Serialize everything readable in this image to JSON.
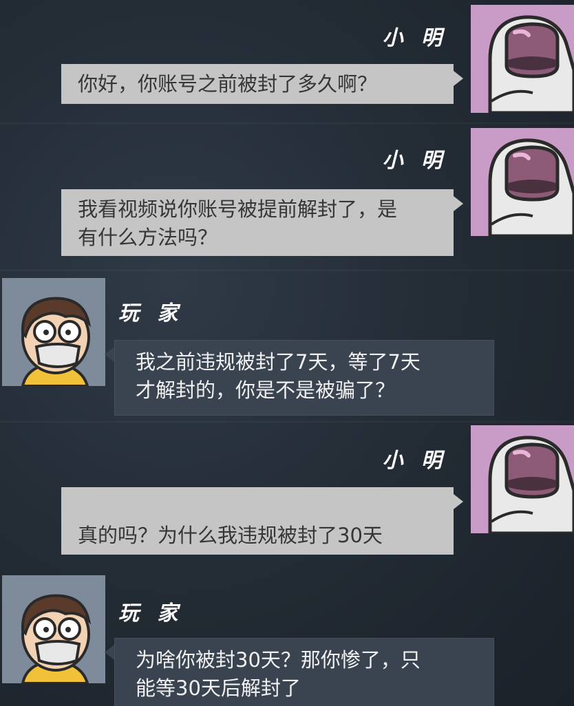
{
  "messages": [
    {
      "sender": "小 明",
      "text": "你好，你账号之前被封了多久啊？"
    },
    {
      "sender": "小 明",
      "text": "我看视频说你账号被提前解封了，是\n有什么方法吗？"
    },
    {
      "sender": "玩 家",
      "text": "我之前违规被封了7天，等了7天\n才解封的，你是不是被骗了？"
    },
    {
      "sender": "小 明",
      "text": "真的吗？为什么我违规被封了30天",
      "emoji": "crying-face-icon"
    },
    {
      "sender": "玩 家",
      "text": "为啥你被封30天？那你惨了，只\n能等30天后解封了"
    }
  ],
  "icons": {
    "xiaoming_avatar": "astronaut-avatar-icon",
    "player_avatar": "player-avatar-icon"
  },
  "colors": {
    "light_bubble": "#c5c5c5",
    "dark_bubble": "#3a4450",
    "astronaut_bg": "#c99bc7"
  }
}
